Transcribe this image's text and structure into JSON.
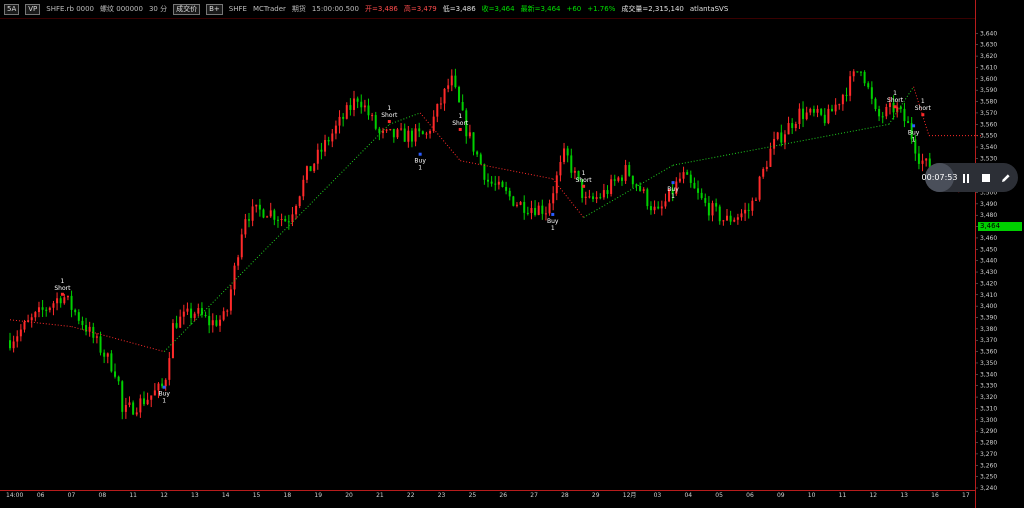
{
  "header": {
    "interval_chip": "5A",
    "vp_chip": "VP",
    "symbol": "SHFE.rb 0000",
    "product": "螺纹 000000",
    "period": "30 分",
    "mode_chip": "成交价",
    "plus_chip": "B+",
    "exchange": "SHFE",
    "platform": "MCTrader",
    "category": "期货",
    "time": "15:00:00.500",
    "open": "开=3,486",
    "high": "高=3,479",
    "low": "低=3,486",
    "close": "收=3,464",
    "last": "最新=3,464",
    "change": "+60",
    "pct": "+1.76%",
    "volume": "成交量=2,315,140",
    "account": "atlantaSVS"
  },
  "recorder": {
    "time": "00:07:53"
  },
  "current_price_tag": "3,464",
  "colors": {
    "up": "#ff2a2a",
    "down": "#00d000",
    "border": "#b81c1c",
    "signal": "#ff2a2a"
  },
  "chart_data": {
    "type": "candlestick",
    "ylim": [
      3240,
      3650
    ],
    "y_ticks": [
      3240,
      3250,
      3260,
      3270,
      3280,
      3290,
      3300,
      3310,
      3320,
      3330,
      3340,
      3350,
      3360,
      3370,
      3380,
      3390,
      3400,
      3410,
      3420,
      3430,
      3440,
      3450,
      3460,
      3470,
      3480,
      3490,
      3500,
      3510,
      3520,
      3530,
      3540,
      3550,
      3560,
      3570,
      3580,
      3590,
      3600,
      3610,
      3620,
      3630,
      3640
    ],
    "x_labels": [
      "14:00",
      "06",
      "07",
      "08",
      "11",
      "12",
      "13",
      "14",
      "15",
      "18",
      "19",
      "20",
      "21",
      "22",
      "23",
      "25",
      "26",
      "27",
      "28",
      "29",
      "12月",
      "03",
      "04",
      "05",
      "06",
      "09",
      "10",
      "11",
      "12",
      "13",
      "16",
      "17"
    ],
    "trend_points": [
      {
        "day": 0.0,
        "price": 3388
      },
      {
        "day": 2.0,
        "price": 3382
      },
      {
        "day": 5.0,
        "price": 3360
      },
      {
        "day": 12.3,
        "price": 3560
      },
      {
        "day": 13.3,
        "price": 3570
      },
      {
        "day": 14.6,
        "price": 3528
      },
      {
        "day": 17.6,
        "price": 3512
      },
      {
        "day": 18.6,
        "price": 3478
      },
      {
        "day": 21.5,
        "price": 3524
      },
      {
        "day": 28.5,
        "price": 3560
      },
      {
        "day": 29.3,
        "price": 3593
      },
      {
        "day": 29.8,
        "price": 3550
      },
      {
        "day": 31.5,
        "price": 3550
      }
    ],
    "anchors": [
      {
        "day": 0.0,
        "price": 3370
      },
      {
        "day": 0.8,
        "price": 3390
      },
      {
        "day": 1.7,
        "price": 3410
      },
      {
        "day": 2.5,
        "price": 3380
      },
      {
        "day": 3.0,
        "price": 3360
      },
      {
        "day": 3.5,
        "price": 3340
      },
      {
        "day": 3.6,
        "price": 3305
      },
      {
        "day": 4.5,
        "price": 3320
      },
      {
        "day": 5.0,
        "price": 3330
      },
      {
        "day": 5.3,
        "price": 3385
      },
      {
        "day": 6.0,
        "price": 3395
      },
      {
        "day": 6.5,
        "price": 3385
      },
      {
        "day": 7.0,
        "price": 3390
      },
      {
        "day": 7.6,
        "price": 3480
      },
      {
        "day": 8.3,
        "price": 3485
      },
      {
        "day": 9.0,
        "price": 3475
      },
      {
        "day": 9.6,
        "price": 3515
      },
      {
        "day": 10.4,
        "price": 3550
      },
      {
        "day": 11.3,
        "price": 3585
      },
      {
        "day": 12.0,
        "price": 3550
      },
      {
        "day": 12.8,
        "price": 3550
      },
      {
        "day": 13.5,
        "price": 3550
      },
      {
        "day": 14.3,
        "price": 3600
      },
      {
        "day": 14.8,
        "price": 3555
      },
      {
        "day": 15.5,
        "price": 3510
      },
      {
        "day": 16.5,
        "price": 3490
      },
      {
        "day": 17.4,
        "price": 3485
      },
      {
        "day": 18.0,
        "price": 3535
      },
      {
        "day": 18.7,
        "price": 3490
      },
      {
        "day": 19.3,
        "price": 3500
      },
      {
        "day": 20.0,
        "price": 3520
      },
      {
        "day": 21.0,
        "price": 3480
      },
      {
        "day": 21.8,
        "price": 3515
      },
      {
        "day": 22.5,
        "price": 3490
      },
      {
        "day": 23.2,
        "price": 3475
      },
      {
        "day": 24.0,
        "price": 3485
      },
      {
        "day": 24.7,
        "price": 3540
      },
      {
        "day": 25.6,
        "price": 3570
      },
      {
        "day": 26.5,
        "price": 3565
      },
      {
        "day": 27.2,
        "price": 3595
      },
      {
        "day": 27.6,
        "price": 3612
      },
      {
        "day": 28.1,
        "price": 3565
      },
      {
        "day": 28.7,
        "price": 3575
      },
      {
        "day": 29.1,
        "price": 3560
      },
      {
        "day": 29.5,
        "price": 3530
      },
      {
        "day": 30.2,
        "price": 3510
      },
      {
        "day": 31.0,
        "price": 3515
      }
    ],
    "signals": [
      {
        "label": "Short",
        "count": "1",
        "day": 1.7,
        "price": 3410,
        "pos": "above",
        "marker": "#ff2a2a"
      },
      {
        "label": "Buy",
        "count": "1",
        "day": 5.0,
        "price": 3330,
        "pos": "below",
        "marker": "#2a5cff"
      },
      {
        "label": "Short",
        "count": "1",
        "day": 12.3,
        "price": 3562,
        "pos": "above",
        "marker": "#ff2a2a"
      },
      {
        "label": "Buy",
        "count": "1",
        "day": 13.3,
        "price": 3535,
        "pos": "below",
        "marker": "#2a5cff"
      },
      {
        "label": "Short",
        "count": "1",
        "day": 14.6,
        "price": 3555,
        "pos": "above",
        "marker": "#ff2a2a"
      },
      {
        "label": "Buy",
        "count": "1",
        "day": 17.6,
        "price": 3482,
        "pos": "below",
        "marker": "#2a5cff"
      },
      {
        "label": "Short",
        "count": "1",
        "day": 18.6,
        "price": 3505,
        "pos": "above",
        "marker": "#ff2a2a"
      },
      {
        "label": "Buy",
        "count": "1",
        "day": 21.5,
        "price": 3510,
        "pos": "below",
        "marker": "#2a5cff"
      },
      {
        "label": "Short",
        "count": "1",
        "day": 28.7,
        "price": 3575,
        "pos": "above",
        "marker": "#ff2a2a"
      },
      {
        "label": "Buy",
        "count": "1",
        "day": 29.3,
        "price": 3560,
        "pos": "below",
        "marker": "#2a5cff"
      },
      {
        "label": "Short",
        "count": "1",
        "day": 29.6,
        "price": 3568,
        "pos": "above",
        "marker": "#ff2a2a"
      }
    ]
  }
}
